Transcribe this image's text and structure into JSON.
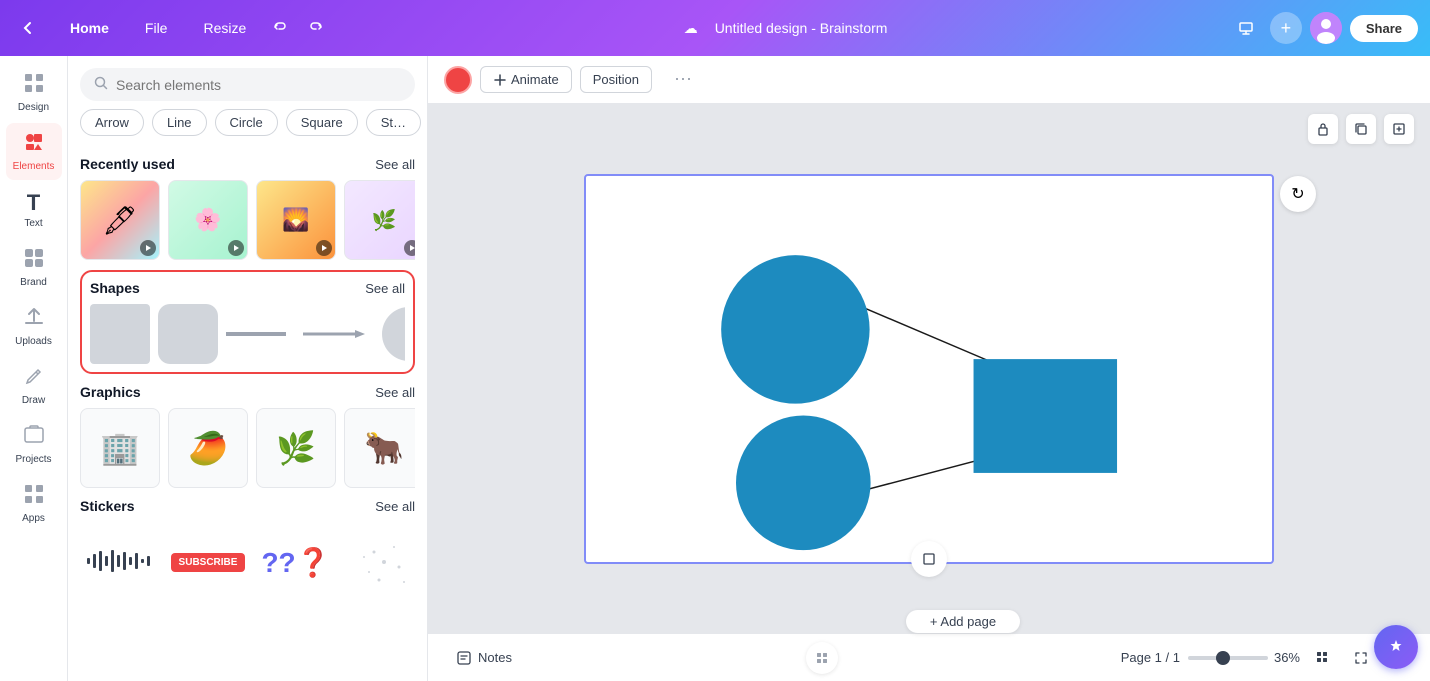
{
  "topbar": {
    "home_label": "Home",
    "file_label": "File",
    "resize_label": "Resize",
    "title": "Untitled design - Brainstorm",
    "share_label": "Share",
    "cloud_icon": "☁"
  },
  "sidebar": {
    "items": [
      {
        "id": "design",
        "label": "Design",
        "icon": "⊞"
      },
      {
        "id": "elements",
        "label": "Elements",
        "icon": "✦",
        "active": true
      },
      {
        "id": "text",
        "label": "Text",
        "icon": "T"
      },
      {
        "id": "brand",
        "label": "Brand",
        "icon": "◈"
      },
      {
        "id": "uploads",
        "label": "Uploads",
        "icon": "↑"
      },
      {
        "id": "draw",
        "label": "Draw",
        "icon": "✏"
      },
      {
        "id": "projects",
        "label": "Projects",
        "icon": "⊡"
      },
      {
        "id": "apps",
        "label": "Apps",
        "icon": "⊞"
      }
    ]
  },
  "elements_panel": {
    "search_placeholder": "Search elements",
    "quick_tags": [
      "Arrow",
      "Line",
      "Circle",
      "Square",
      "St…"
    ],
    "recently_used": {
      "title": "Recently used",
      "see_all": "See all"
    },
    "shapes": {
      "title": "Shapes",
      "see_all": "See all"
    },
    "graphics": {
      "title": "Graphics",
      "see_all": "See all"
    },
    "stickers": {
      "title": "Stickers",
      "see_all": "See all"
    }
  },
  "subtoolbar": {
    "animate_label": "Animate",
    "position_label": "Position",
    "color_hex": "#ef4444"
  },
  "canvas": {
    "refresh_icon": "↻"
  },
  "bottom_bar": {
    "add_page_label": "+ Add page",
    "page_info": "Page 1 / 1",
    "zoom_percent": "36%",
    "notes_label": "Notes",
    "notes_icon": "📝"
  }
}
